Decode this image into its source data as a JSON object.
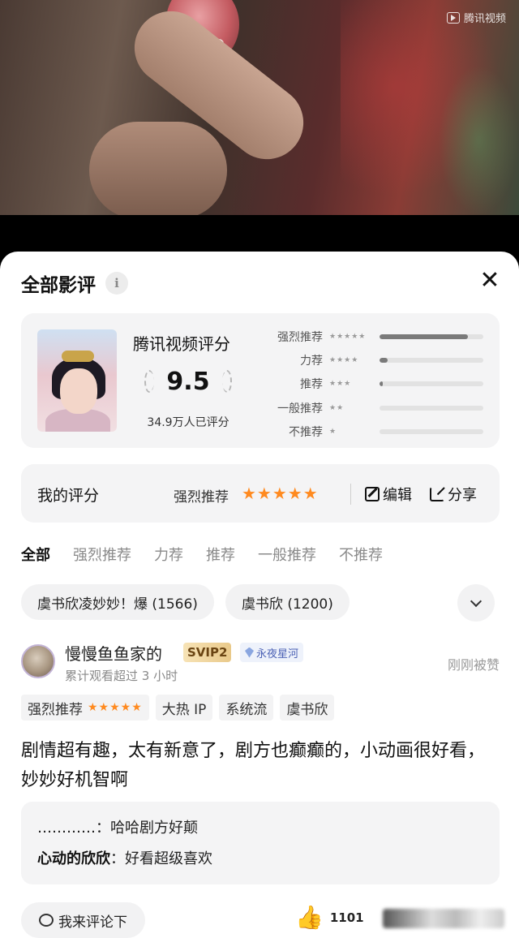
{
  "video": {
    "watermark": "腾讯视频"
  },
  "sheet": {
    "title": "全部影评",
    "info_icon": "i"
  },
  "score_card": {
    "platform": "腾讯视频评分",
    "score": "9.5",
    "rated_count": "34.9万人已评分",
    "distribution": [
      {
        "label": "强烈推荐",
        "stars": "★★★★★",
        "fill": 0.85
      },
      {
        "label": "力荐",
        "stars": "★★★★",
        "fill": 0.08
      },
      {
        "label": "推荐",
        "stars": "★★★",
        "fill": 0.03
      },
      {
        "label": "一般推荐",
        "stars": "★★",
        "fill": 0.0
      },
      {
        "label": "不推荐",
        "stars": "★",
        "fill": 0.0
      }
    ]
  },
  "my_rating": {
    "label": "我的评分",
    "level": "强烈推荐",
    "stars": "★★★★★",
    "edit": "编辑",
    "share": "分享"
  },
  "tabs": [
    "全部",
    "强烈推荐",
    "力荐",
    "推荐",
    "一般推荐",
    "不推荐"
  ],
  "chips": [
    "虞书欣凌妙妙！爆 (1566)",
    "虞书欣 (1200)"
  ],
  "review": {
    "user": "慢慢鱼鱼家的",
    "vip": "SVIP2",
    "badge": "永夜星河",
    "watch_time": "累计观看超过 3 小时",
    "status": "刚刚被赞",
    "rating_tag": "强烈推荐",
    "rating_stars": "★★★★★",
    "tags": [
      "大热 IP",
      "系统流",
      "虞书欣"
    ],
    "text": "剧情超有趣，太有新意了，剧方也癫癫的，小动画很好看，妙妙好机智啊",
    "replies": [
      {
        "who": "…………",
        "text": "：哈哈剧方好颠"
      },
      {
        "who": "心动的欣欣",
        "text": "：好看超级喜欢"
      }
    ],
    "comment_button": "我来评论下",
    "like_count": "1101"
  },
  "colors": {
    "star": "#ff8a1f",
    "svip_gold": "#e9c98a",
    "card_bg": "#f4f4f5"
  }
}
